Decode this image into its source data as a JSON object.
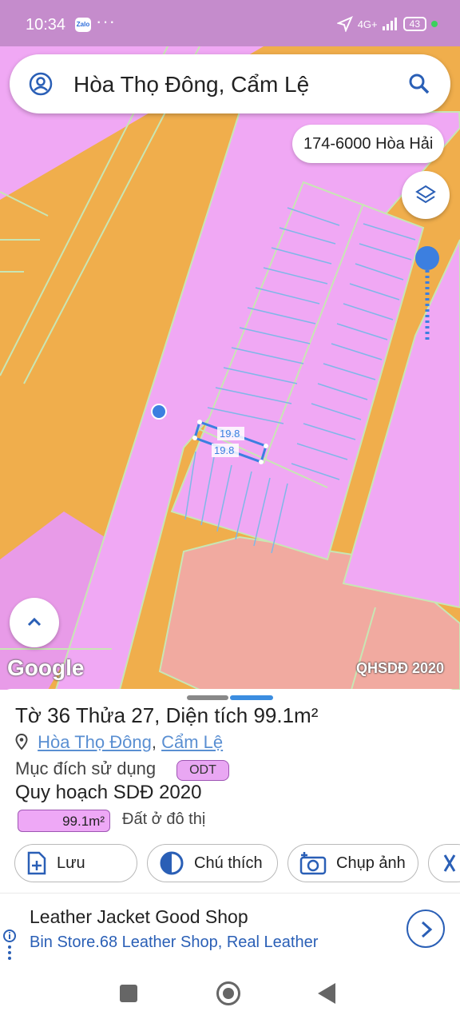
{
  "status_bar": {
    "time": "10:34",
    "app_badge": "Zalo",
    "dots": "···",
    "network": "4G+",
    "battery": "43"
  },
  "search": {
    "query": "Hòa Thọ Đông, Cẩm Lệ"
  },
  "map": {
    "area_chip": "174-6000 Hòa Hải",
    "parcel_width_labels": [
      "19.8",
      "19.8"
    ],
    "logo": "Google",
    "source": "QHSDĐ 2020",
    "colors": {
      "residential": "#f0a8f4",
      "road": "#f0ae4c",
      "other_land": "#f1aaa0"
    }
  },
  "details": {
    "title": "Tờ 36 Thửa 27, Diện tích 99.1m²",
    "ward": "Hòa Thọ Đông",
    "separator": ",",
    "district": "Cẩm Lệ",
    "purpose_label": "Mục đích sử dụng",
    "purpose_code": "ODT",
    "plan_title": "Quy hoạch SDĐ 2020",
    "area_value": "99.1m²",
    "land_type": "Đất ở đô thị"
  },
  "actions": [
    {
      "label": "Lưu",
      "icon": "add-file-icon"
    },
    {
      "label": "Chú thích",
      "icon": "contrast-icon"
    },
    {
      "label": "Chụp ảnh",
      "icon": "camera-icon"
    }
  ],
  "ad": {
    "title": "Leather Jacket Good Shop",
    "subtitle": "Bin Store.68 Leather Shop, Real Leather",
    "accent": "#2a5fb6"
  }
}
